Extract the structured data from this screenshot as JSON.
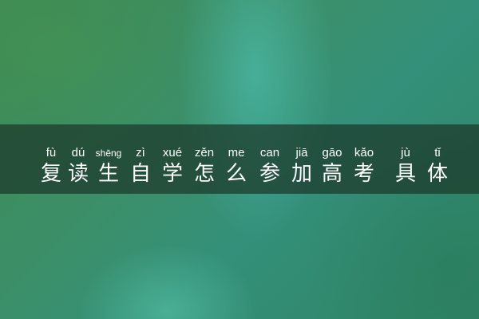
{
  "title": {
    "characters": [
      {
        "pinyin": "fù",
        "hanzi": "复"
      },
      {
        "pinyin": "dú",
        "hanzi": "读"
      },
      {
        "pinyin": "shēng",
        "hanzi": "生"
      },
      {
        "pinyin": "zì",
        "hanzi": "自"
      },
      {
        "pinyin": "xué",
        "hanzi": "学"
      },
      {
        "pinyin": "zěn",
        "hanzi": "怎"
      },
      {
        "pinyin": "me",
        "hanzi": "么"
      },
      {
        "pinyin": "can",
        "hanzi": "参"
      },
      {
        "pinyin": "jiā",
        "hanzi": "加"
      },
      {
        "pinyin": "gāo",
        "hanzi": "高"
      },
      {
        "pinyin": "kǎo",
        "hanzi": "考"
      },
      {
        "pinyin": "jù",
        "hanzi": "具"
      },
      {
        "pinyin": "tǐ",
        "hanzi": "体"
      }
    ]
  }
}
